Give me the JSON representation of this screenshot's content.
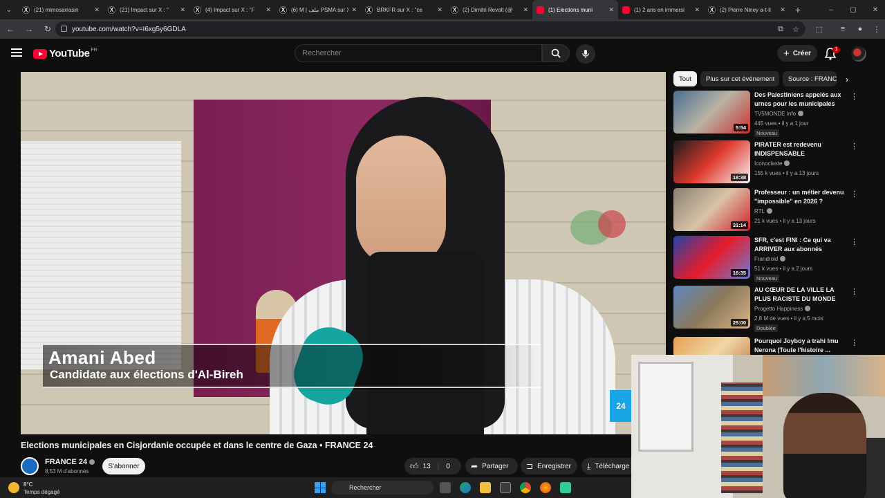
{
  "browser": {
    "tabs": [
      {
        "title": "(21) mimosarrasin",
        "favicon": "x-icon",
        "active": false
      },
      {
        "title": "(21) Impact sur X : \"",
        "favicon": "x-icon",
        "active": false
      },
      {
        "title": "(4) Impact sur X : \"F",
        "favicon": "x-icon",
        "active": false
      },
      {
        "title": "(6) M | ملف PSMA sur X",
        "favicon": "x-icon",
        "active": false
      },
      {
        "title": "BRKFR sur X : \"ce",
        "favicon": "x-icon",
        "active": false
      },
      {
        "title": "(2) Dimitri Revolt (@",
        "favicon": "x-icon",
        "active": false
      },
      {
        "title": "(1) Elections muni",
        "favicon": "youtube-icon",
        "active": true
      },
      {
        "title": "(1) 2 ans en immersi",
        "favicon": "youtube-icon",
        "active": false
      },
      {
        "title": "(2) Pierre Niney a-t-il",
        "favicon": "x-icon",
        "active": false
      }
    ],
    "new_tab_label": "+",
    "url": "youtube.com/watch?v=I6xg5y6GDLA"
  },
  "youtube": {
    "logo_text": "YouTube",
    "country_code": "FR",
    "search_placeholder": "Rechercher",
    "create_label": "Créer",
    "notification_count": "1"
  },
  "video": {
    "overlay_name": "Amani Abed",
    "overlay_role": "Candidate aux élections d'Al-Bireh",
    "logo_text": "24",
    "title": "Elections municipales en Cisjordanie occupée et dans le centre de Gaza • FRANCE 24",
    "channel_name": "FRANCE 24",
    "channel_subs": "8,53 M d'abonnés",
    "subscribe_label": "S'abonner",
    "likes": "13",
    "dislikes": "0",
    "share_label": "Partager",
    "save_label": "Enregistrer",
    "download_label": "Télécharge"
  },
  "sidebar": {
    "chips": [
      "Tout",
      "Plus sur cet événement",
      "Source : FRANCE"
    ],
    "recommendations": [
      {
        "title": "Des Palestiniens appelés aux urnes pour les municipales",
        "channel": "TV5MONDE Info",
        "meta": "445 vues • il y a 1 jour",
        "badge": "Nouveau",
        "duration": "5:54",
        "colors": [
          "#4a6e8f",
          "#b9b3a6",
          "#c9322c"
        ]
      },
      {
        "title": "PIRATER est redevenu INDISPENSABLE",
        "channel": "Iconoclaste",
        "meta": "155 k vues • il y a 13 jours",
        "badge": "",
        "duration": "18:38",
        "colors": [
          "#1b1b1b",
          "#e23b2e",
          "#f5f5f5"
        ]
      },
      {
        "title": "Professeur : un métier devenu \"impossible\" en 2026 ?",
        "channel": "RTL",
        "meta": "21 k vues • il y a 13 jours",
        "badge": "",
        "duration": "31:14",
        "colors": [
          "#8a7f73",
          "#d9c3a6",
          "#d4202a"
        ]
      },
      {
        "title": "SFR, c'est FINI : Ce qui va ARRIVER aux abonnés",
        "channel": "Frandroid",
        "meta": "51 k vues • il y a 2 jours",
        "badge": "Nouveau",
        "duration": "16:35",
        "colors": [
          "#2244aa",
          "#e61b2a",
          "#6a7cd6"
        ]
      },
      {
        "title": "AU CŒUR DE LA VILLE LA PLUS RACISTE DU MONDE",
        "channel": "Progetto Happiness",
        "meta": "2,8 M de vues • il y a 5 mois",
        "badge": "Doublée",
        "duration": "25:00",
        "colors": [
          "#5f86bf",
          "#8b7a5a",
          "#d9b48a"
        ]
      },
      {
        "title": "Pourquoi Joyboy a trahi Imu Nerona (Toute l'histoire ...",
        "channel": "",
        "meta": "",
        "badge": "",
        "duration": "",
        "colors": [
          "#e7a04f",
          "#f0d7a8",
          "#bb6b35"
        ]
      }
    ]
  },
  "taskbar": {
    "weather_temp": "8°C",
    "weather_desc": "Temps dégagé",
    "search_placeholder": "Rechercher"
  }
}
